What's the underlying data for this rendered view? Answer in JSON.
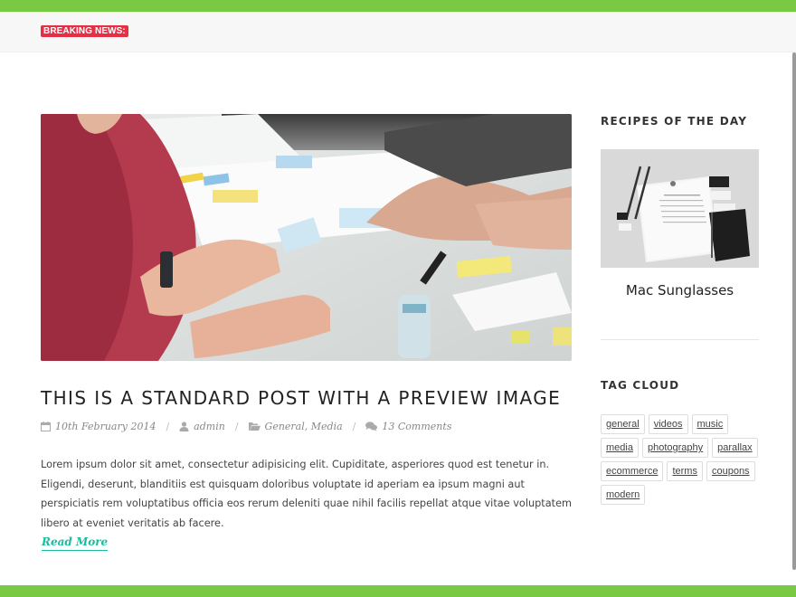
{
  "colors": {
    "accent_green": "#7ac943",
    "breaking_red": "#e42f45",
    "link_teal": "#1abc9c"
  },
  "header": {
    "breaking_label": "BREAKING NEWS:"
  },
  "post": {
    "image_icon": "photo-office-meeting",
    "title": "THIS IS A STANDARD POST WITH A PREVIEW IMAGE",
    "meta": {
      "date": "10th February 2014",
      "author": "admin",
      "categories": "General, Media",
      "comments": "13 Comments",
      "separator": "/"
    },
    "excerpt": "Lorem ipsum dolor sit amet, consectetur adipisicing elit. Cupiditate, asperiores quod est tenetur in. Eligendi, deserunt, blanditiis est quisquam doloribus voluptate id aperiam ea ipsum magni aut perspiciatis rem voluptatibus officia eos rerum deleniti quae nihil facilis repellat atque vitae voluptatem libero at eveniet veritatis ab facere.",
    "read_more": "Read More"
  },
  "sidebar": {
    "recipes": {
      "title": "RECIPES OF THE DAY",
      "item": {
        "name": "Mac Sunglasses",
        "image_icon": "stationery-mockup"
      }
    },
    "tags": {
      "title": "TAG CLOUD",
      "items": [
        "general",
        "videos",
        "music",
        "media",
        "photography",
        "parallax",
        "ecommerce",
        "terms",
        "coupons",
        "modern"
      ]
    }
  }
}
